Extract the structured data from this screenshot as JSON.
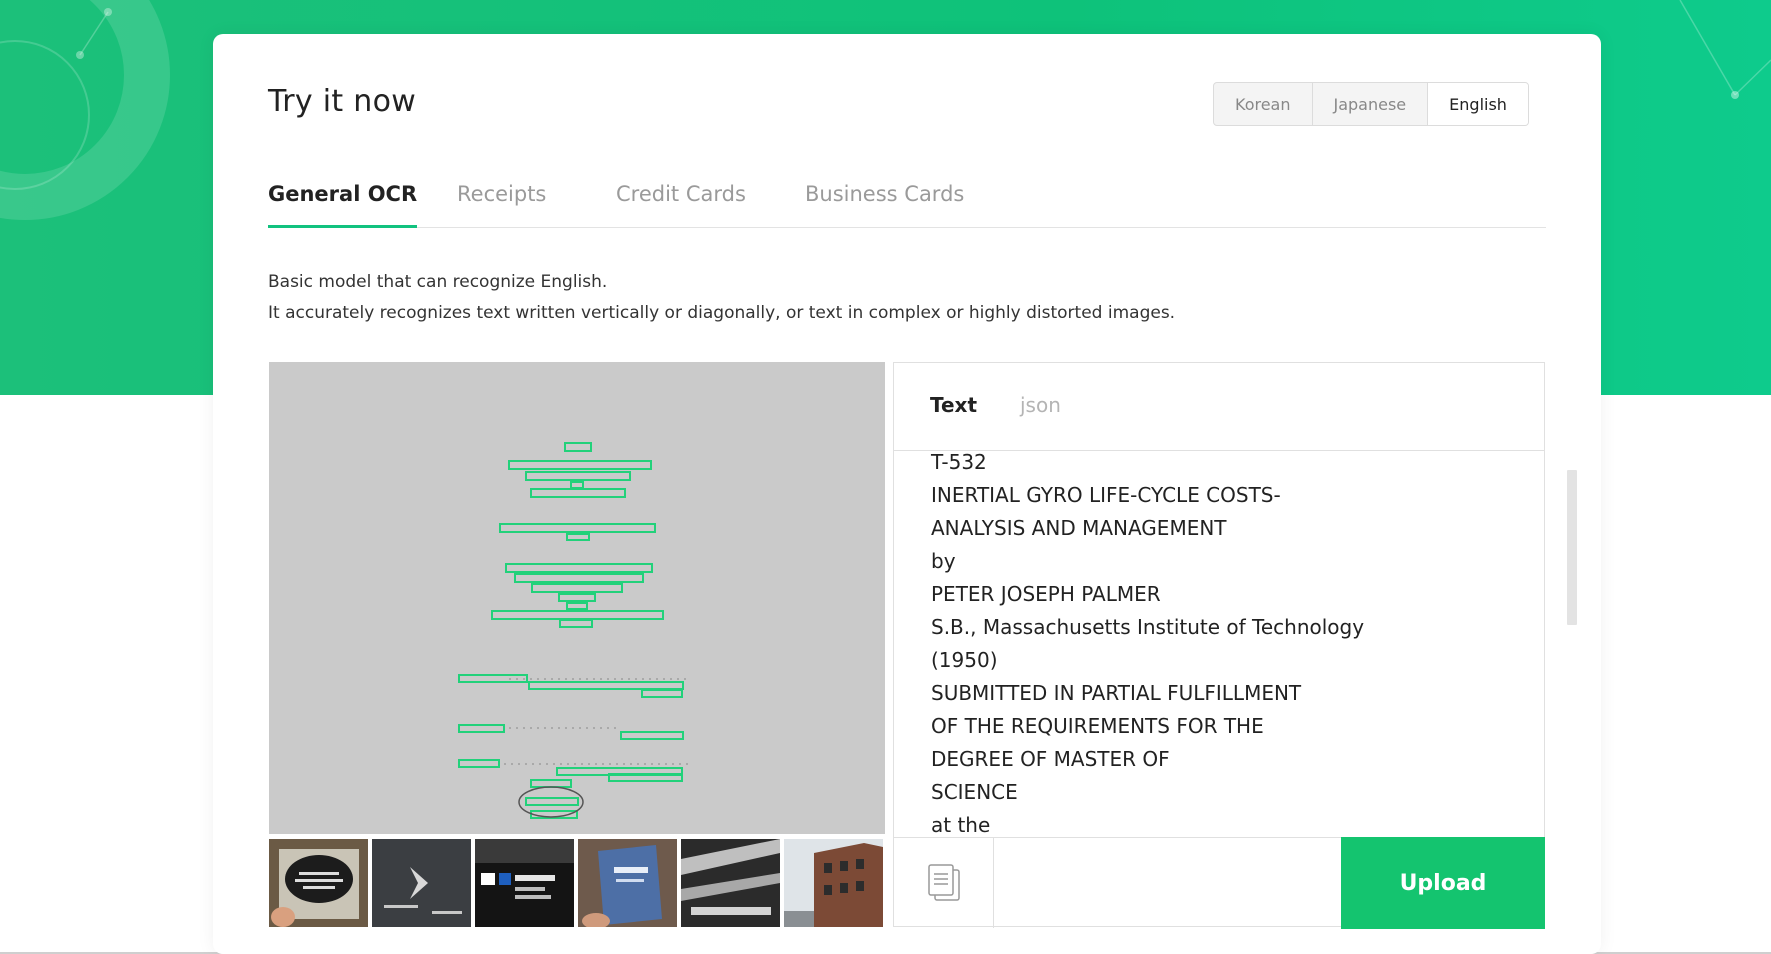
{
  "card": {
    "title": "Try it now"
  },
  "languages": [
    {
      "label": "Korean",
      "active": false
    },
    {
      "label": "Japanese",
      "active": false
    },
    {
      "label": "English",
      "active": true
    }
  ],
  "tabs": [
    {
      "label": "General OCR",
      "active": true
    },
    {
      "label": "Receipts",
      "active": false
    },
    {
      "label": "Credit Cards",
      "active": false
    },
    {
      "label": "Business Cards",
      "active": false
    }
  ],
  "description": {
    "line1": "Basic model that can recognize English.",
    "line2": "It accurately recognizes text written vertically or diagonally, or text in complex or highly distorted images."
  },
  "result": {
    "tabs": [
      {
        "label": "Text",
        "active": true
      },
      {
        "label": "json",
        "active": false
      }
    ],
    "lines": [
      "T-532",
      "INERTIAL GYRO LIFE-CYCLE COSTS-",
      "ANALYSIS AND MANAGEMENT",
      "by",
      "PETER JOSEPH PALMER",
      "S.B., Massachusetts Institute of Technology",
      "(1950)",
      "SUBMITTED IN PARTIAL FULFILLMENT",
      "OF THE REQUIREMENTS FOR THE",
      "DEGREE OF MASTER OF",
      "SCIENCE",
      "at the"
    ],
    "copy_icon": "copy-document-icon",
    "upload_label": "Upload"
  },
  "thumbnails": [
    {
      "name": "thumb-handheld-sign",
      "icon": "photo-thumbnail"
    },
    {
      "name": "thumb-dark-card",
      "icon": "photo-thumbnail"
    },
    {
      "name": "thumb-subway-sign",
      "icon": "photo-thumbnail"
    },
    {
      "name": "thumb-blue-brochure",
      "icon": "photo-thumbnail"
    },
    {
      "name": "thumb-overhead-signs",
      "icon": "photo-thumbnail"
    },
    {
      "name": "thumb-brick-building",
      "icon": "photo-thumbnail"
    }
  ],
  "colors": {
    "brand_green": "#14c46f",
    "active_tab_underline": "#11c27f",
    "detection_box": "#22d17a",
    "preview_background": "#cacaca"
  }
}
